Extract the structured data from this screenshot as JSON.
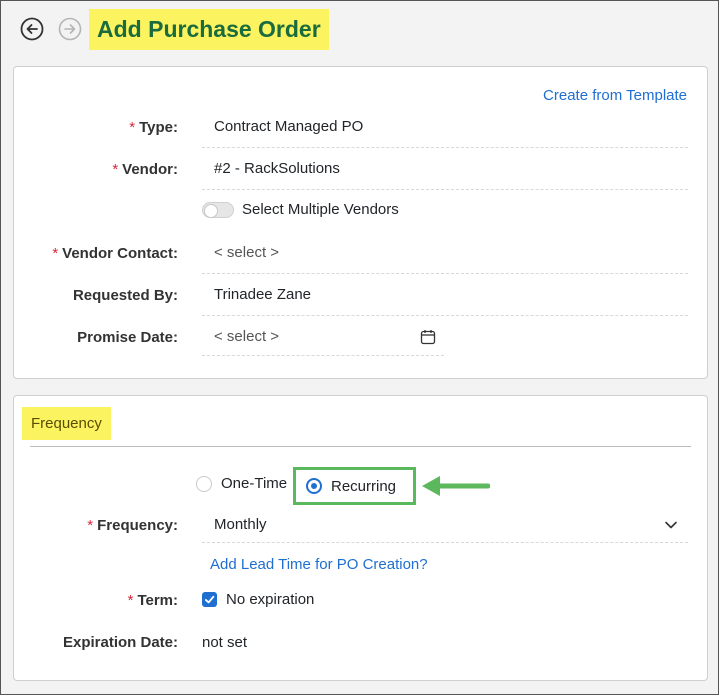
{
  "header": {
    "title": "Add Purchase Order"
  },
  "details": {
    "template_link": "Create from Template",
    "type_label": "Type:",
    "type_value": "Contract Managed PO",
    "vendor_label": "Vendor:",
    "vendor_value": "#2 - RackSolutions",
    "multi_vendor_label": "Select Multiple Vendors",
    "vendor_contact_label": "Vendor Contact:",
    "vendor_contact_value": "< select >",
    "requested_by_label": "Requested By:",
    "requested_by_value": "Trinadee Zane",
    "promise_date_label": "Promise Date:",
    "promise_date_value": "< select >",
    "required_marker": "*"
  },
  "frequency": {
    "section_title": "Frequency",
    "option_one_time": "One-Time",
    "option_recurring": "Recurring",
    "selected_option": "Recurring",
    "frequency_label": "Frequency:",
    "frequency_value": "Monthly",
    "lead_time_link": "Add Lead Time for PO Creation?",
    "term_label": "Term:",
    "term_checkbox_label": "No expiration",
    "term_checked": true,
    "expiration_label": "Expiration Date:",
    "expiration_value": "not set"
  },
  "colors": {
    "highlight": "#fbf35f",
    "title_text": "#1a6b3d",
    "link": "#1f6fd1",
    "required": "#d9263a",
    "annotation_green": "#5cb85c"
  },
  "icons": [
    "back-arrow-icon",
    "forward-arrow-icon",
    "calendar-icon",
    "chevron-down-icon",
    "checkmark-icon",
    "annotation-arrow-icon"
  ]
}
